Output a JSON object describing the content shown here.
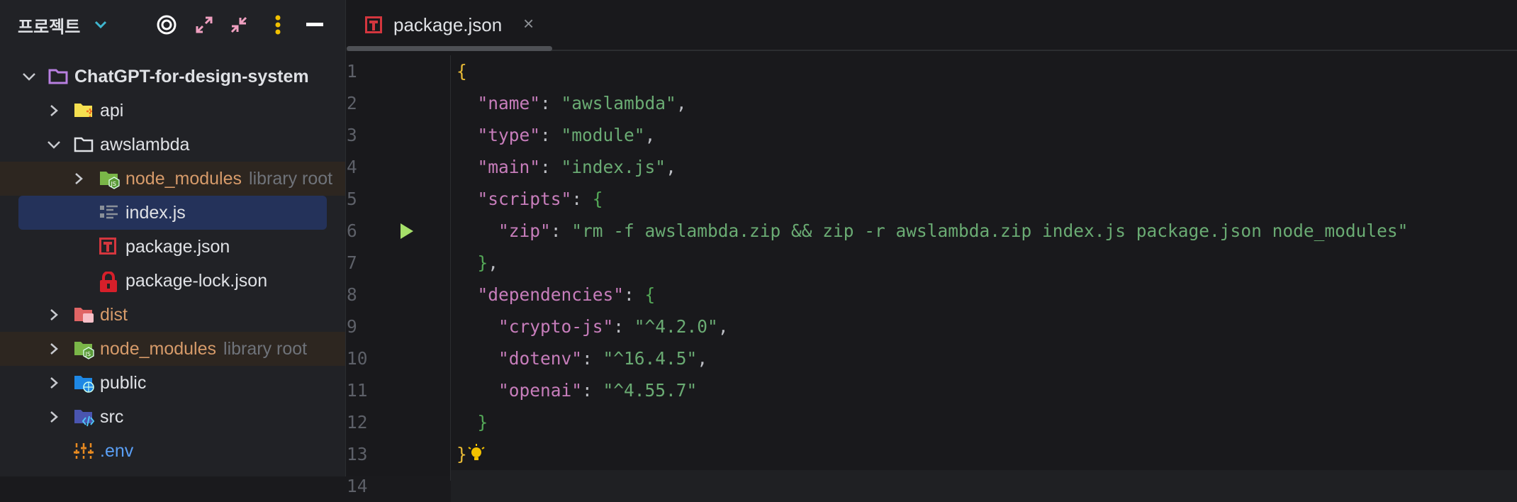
{
  "sidebar": {
    "title": "프로젝트",
    "header_icons": [
      "locate-icon",
      "expand-all-icon",
      "collapse-all-icon",
      "more-options-icon",
      "hide-icon"
    ],
    "tree": [
      {
        "label": "ChatGPT-for-design-system",
        "level": 0,
        "expanded": true,
        "icon": "project-folder-icon",
        "bold": true
      },
      {
        "label": "api",
        "level": 1,
        "expanded": false,
        "icon": "api-folder-icon"
      },
      {
        "label": "awslambda",
        "level": 1,
        "expanded": true,
        "icon": "folder-icon"
      },
      {
        "label": "node_modules",
        "hint": "library root",
        "level": 2,
        "expanded": false,
        "icon": "node-folder-icon"
      },
      {
        "label": "index.js",
        "level": 2,
        "icon": "js-file-icon",
        "selected": true
      },
      {
        "label": "package.json",
        "level": 2,
        "icon": "npm-icon"
      },
      {
        "label": "package-lock.json",
        "level": 2,
        "icon": "lock-icon"
      },
      {
        "label": "dist",
        "level": 1,
        "expanded": false,
        "icon": "dist-folder-icon"
      },
      {
        "label": "node_modules",
        "hint": "library root",
        "level": 1,
        "expanded": false,
        "icon": "node-folder-icon"
      },
      {
        "label": "public",
        "level": 1,
        "expanded": false,
        "icon": "public-folder-icon"
      },
      {
        "label": "src",
        "level": 1,
        "expanded": false,
        "icon": "src-folder-icon"
      },
      {
        "label": ".env",
        "level": 1,
        "icon": "env-file-icon"
      }
    ]
  },
  "editor": {
    "tab": {
      "label": "package.json",
      "close": "×"
    },
    "lines": [
      [
        [
          "b1",
          "{"
        ]
      ],
      [
        [
          "p",
          "  "
        ],
        [
          "k",
          "\"name\""
        ],
        [
          "p",
          ": "
        ],
        [
          "s",
          "\"awslambda\""
        ],
        [
          "p",
          ","
        ]
      ],
      [
        [
          "p",
          "  "
        ],
        [
          "k",
          "\"type\""
        ],
        [
          "p",
          ": "
        ],
        [
          "s",
          "\"module\""
        ],
        [
          "p",
          ","
        ]
      ],
      [
        [
          "p",
          "  "
        ],
        [
          "k",
          "\"main\""
        ],
        [
          "p",
          ": "
        ],
        [
          "s",
          "\"index.js\""
        ],
        [
          "p",
          ","
        ]
      ],
      [
        [
          "p",
          "  "
        ],
        [
          "k",
          "\"scripts\""
        ],
        [
          "p",
          ": "
        ],
        [
          "b2",
          "{"
        ]
      ],
      [
        [
          "p",
          "    "
        ],
        [
          "k",
          "\"zip\""
        ],
        [
          "p",
          ": "
        ],
        [
          "s",
          "\"rm -f awslambda.zip && zip -r awslambda.zip index.js package.json node_modules\""
        ]
      ],
      [
        [
          "p",
          "  "
        ],
        [
          "b2",
          "}"
        ],
        [
          "p",
          ","
        ]
      ],
      [
        [
          "p",
          "  "
        ],
        [
          "k",
          "\"dependencies\""
        ],
        [
          "p",
          ": "
        ],
        [
          "b2",
          "{"
        ]
      ],
      [
        [
          "p",
          "    "
        ],
        [
          "k",
          "\"crypto-js\""
        ],
        [
          "p",
          ": "
        ],
        [
          "s",
          "\"^4.2.0\""
        ],
        [
          "p",
          ","
        ]
      ],
      [
        [
          "p",
          "    "
        ],
        [
          "k",
          "\"dotenv\""
        ],
        [
          "p",
          ": "
        ],
        [
          "s",
          "\"^16.4.5\""
        ],
        [
          "p",
          ","
        ]
      ],
      [
        [
          "p",
          "    "
        ],
        [
          "k",
          "\"openai\""
        ],
        [
          "p",
          ": "
        ],
        [
          "s",
          "\"^4.55.7\""
        ]
      ],
      [
        [
          "p",
          "  "
        ],
        [
          "b2",
          "}"
        ]
      ],
      [
        [
          "b1",
          "}"
        ]
      ],
      []
    ],
    "line_numbers": [
      "1",
      "2",
      "3",
      "4",
      "5",
      "6",
      "7",
      "8",
      "9",
      "10",
      "11",
      "12",
      "13",
      "14"
    ]
  }
}
